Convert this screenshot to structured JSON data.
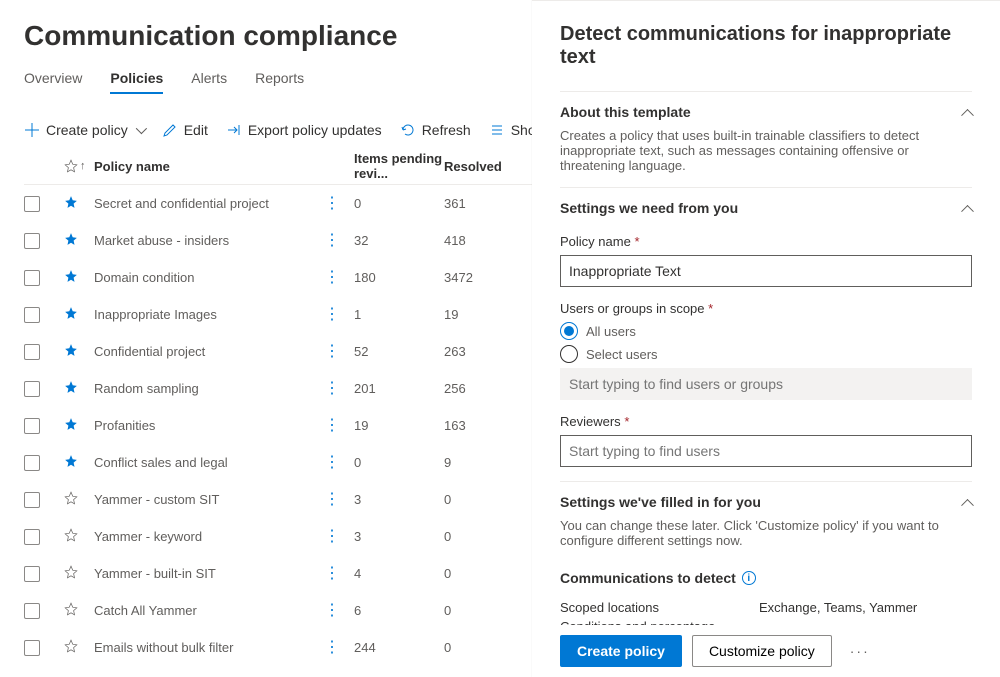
{
  "page": {
    "title": "Communication compliance"
  },
  "tabs": {
    "overview": "Overview",
    "policies": "Policies",
    "alerts": "Alerts",
    "reports": "Reports"
  },
  "toolbar": {
    "create": "Create policy",
    "edit": "Edit",
    "export": "Export policy updates",
    "refresh": "Refresh",
    "show": "Show"
  },
  "table": {
    "headers": {
      "policy_name": "Policy name",
      "items_pending": "Items pending revi...",
      "resolved": "Resolved"
    },
    "rows": [
      {
        "starred": true,
        "name": "Secret and confidential project",
        "items": "0",
        "resolved": "361"
      },
      {
        "starred": true,
        "name": "Market abuse - insiders",
        "items": "32",
        "resolved": "418"
      },
      {
        "starred": true,
        "name": "Domain condition",
        "items": "180",
        "resolved": "3472"
      },
      {
        "starred": true,
        "name": "Inappropriate Images",
        "items": "1",
        "resolved": "19"
      },
      {
        "starred": true,
        "name": "Confidential project",
        "items": "52",
        "resolved": "263"
      },
      {
        "starred": true,
        "name": "Random sampling",
        "items": "201",
        "resolved": "256"
      },
      {
        "starred": true,
        "name": "Profanities",
        "items": "19",
        "resolved": "163"
      },
      {
        "starred": true,
        "name": "Conflict sales and legal",
        "items": "0",
        "resolved": "9"
      },
      {
        "starred": false,
        "name": "Yammer - custom SIT",
        "items": "3",
        "resolved": "0"
      },
      {
        "starred": false,
        "name": "Yammer - keyword",
        "items": "3",
        "resolved": "0"
      },
      {
        "starred": false,
        "name": "Yammer - built-in SIT",
        "items": "4",
        "resolved": "0"
      },
      {
        "starred": false,
        "name": "Catch All Yammer",
        "items": "6",
        "resolved": "0"
      },
      {
        "starred": false,
        "name": "Emails without bulk filter",
        "items": "244",
        "resolved": "0"
      }
    ]
  },
  "panel": {
    "title": "Detect communications for inappropriate text",
    "about": {
      "heading": "About this template",
      "body": "Creates a policy that uses built-in trainable classifiers to detect inappropriate text, such as messages containing offensive or threatening language."
    },
    "settings_needed": {
      "heading": "Settings we need from you",
      "policy_name_label": "Policy name",
      "policy_name_value": "Inappropriate Text",
      "scope_label": "Users or groups in scope",
      "scope_all": "All users",
      "scope_select": "Select users",
      "scope_placeholder": "Start typing to find users or groups",
      "reviewers_label": "Reviewers",
      "reviewers_placeholder": "Start typing to find users"
    },
    "settings_filled": {
      "heading": "Settings we've filled in for you",
      "body": "You can change these later. Click 'Customize policy' if you want to configure different settings now.",
      "comm_label": "Communications to detect",
      "scoped_label": "Scoped locations",
      "scoped_value": "Exchange, Teams, Yammer",
      "conditions_label": "Conditions and percentage"
    },
    "footer": {
      "create": "Create policy",
      "customize": "Customize policy"
    }
  }
}
